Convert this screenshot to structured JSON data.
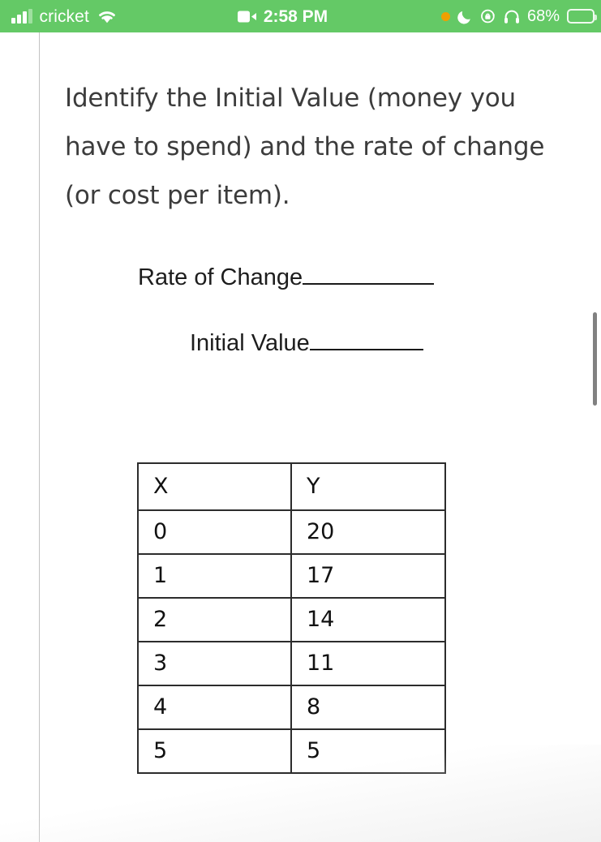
{
  "status_bar": {
    "carrier": "cricket",
    "signal_icon": "signal-bars-icon",
    "wifi_icon": "wifi-icon",
    "screen_record_icon": "video-camera-icon",
    "time": "2:58 PM",
    "recording_dot_icon": "orange-recording-dot-icon",
    "do_not_disturb_icon": "crescent-moon-icon",
    "rotation_lock_icon": "rotation-lock-icon",
    "headphones_icon": "headphones-icon",
    "battery_percent": "68%",
    "battery_icon": "battery-icon",
    "background_color": "#64c966",
    "foreground_color": "#ffffff"
  },
  "document": {
    "question_prompt": "Identify the Initial Value (money you have to spend) and the rate of change (or cost per item).",
    "blanks": [
      {
        "label": "Rate of Change",
        "value": ""
      },
      {
        "label": "Initial Value",
        "value": ""
      }
    ],
    "table": {
      "headers": [
        "X",
        "Y"
      ],
      "rows": [
        [
          "0",
          "20"
        ],
        [
          "1",
          "17"
        ],
        [
          "2",
          "14"
        ],
        [
          "3",
          "11"
        ],
        [
          "4",
          "8"
        ],
        [
          "5",
          "5"
        ]
      ]
    }
  },
  "chart_data": {
    "type": "table",
    "title": "",
    "xlabel": "X",
    "ylabel": "Y",
    "categories": [
      "0",
      "1",
      "2",
      "3",
      "4",
      "5"
    ],
    "series": [
      {
        "name": "Y",
        "values": [
          20,
          17,
          14,
          11,
          8,
          5
        ]
      }
    ],
    "x": [
      0,
      1,
      2,
      3,
      4,
      5
    ],
    "values": [
      20,
      17,
      14,
      11,
      8,
      5
    ]
  },
  "scrollbar": {
    "orientation": "vertical",
    "color": "#818181"
  }
}
